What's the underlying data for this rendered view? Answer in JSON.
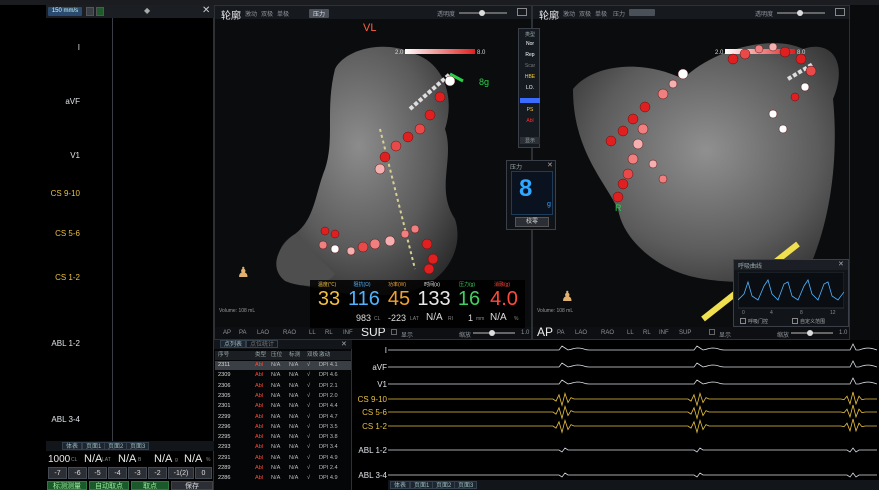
{
  "top": {
    "speed": "150 mm/s"
  },
  "left_panel": {
    "channels": [
      {
        "label": "I",
        "cs": false
      },
      {
        "label": "aVF",
        "cs": false
      },
      {
        "label": "V1",
        "cs": false
      },
      {
        "label": "CS 9-10",
        "cs": true
      },
      {
        "label": "CS 5-6",
        "cs": true
      },
      {
        "label": "CS 1-2",
        "cs": true
      },
      {
        "label": "ABL 1-2",
        "cs": false
      },
      {
        "label": "ABL 3-4",
        "cs": false
      }
    ],
    "tabs": [
      "体表",
      "页面1",
      "页面2",
      "页面3"
    ],
    "cl_row": {
      "cl_value": "1000",
      "cl_unit": "CL",
      "lat": "N/A",
      "lat_unit": "LAT",
      "b": "N/A",
      "b_unit": "B",
      "g": "N/A",
      "g_unit": "g",
      "pct": "N/A",
      "pct_unit": "%"
    },
    "steps": [
      "-7",
      "-6",
      "-5",
      "-4",
      "-3",
      "-2",
      "-1(2)",
      "0"
    ],
    "bottom_buttons": [
      "标测测量",
      "自动取点",
      "取点",
      "保存"
    ]
  },
  "viewport_left": {
    "title": "轮廓",
    "menu": [
      "激动",
      "双极",
      "单极",
      "压力"
    ],
    "transparency_label": "透明度",
    "scale_min": "2.0",
    "scale_max": "8.0",
    "volume": "Volume: 108 mL",
    "views": [
      "AP",
      "PA",
      "LAO",
      "RAO",
      "LL",
      "RL",
      "INF"
    ],
    "current_view": "SUP",
    "display_toggle": "显示",
    "zoom_label": "缩放",
    "zoom_value": "1.0",
    "label_top": "VL",
    "force_marker": "8g"
  },
  "viewport_right": {
    "title": "轮廓",
    "menu": [
      "激动",
      "双极",
      "单极",
      "压力"
    ],
    "transparency_label": "透明度",
    "scale_min": "2.0",
    "scale_max": "8.0",
    "volume": "Volume: 108 mL",
    "views": [
      "PA",
      "LAO",
      "RAO",
      "LL",
      "RL",
      "INF",
      "SUP"
    ],
    "current_view": "AP",
    "display_toggle": "显示",
    "zoom_label": "缩放",
    "zoom_value": "1.0",
    "marker_r": "R"
  },
  "legend": {
    "title": "类型",
    "items": [
      {
        "label": "Nor",
        "color": "#ffffff"
      },
      {
        "label": "Rep",
        "color": "#ffffff"
      },
      {
        "label": "Scar",
        "color": "#7a7a7a"
      },
      {
        "label": "HBE",
        "color": "#ffd23a"
      },
      {
        "label": "LO.",
        "color": "#ffffff"
      },
      {
        "label": "",
        "color": "#3a6cff"
      },
      {
        "label": "PS",
        "color": "#ffd23a"
      },
      {
        "label": "Abl",
        "color": "#ff3030"
      }
    ],
    "footer": "显示"
  },
  "force_panel": {
    "title": "压力",
    "value": "8",
    "unit": "g",
    "button": "校零"
  },
  "readout": {
    "cells": [
      {
        "label": "温度(℃)",
        "value": "33",
        "color": "#f0c040"
      },
      {
        "label": "阻抗(Ω)",
        "value": "116",
        "color": "#4fb3ff"
      },
      {
        "label": "功率(W)",
        "value": "45",
        "color": "#f0a030"
      },
      {
        "label": "时间(s)",
        "value": "133",
        "color": "#e8e8e8"
      },
      {
        "label": "压力(g)",
        "value": "16",
        "color": "#40d060"
      },
      {
        "label": "消融(g)",
        "value": "4.0",
        "color": "#ff4a3a"
      }
    ],
    "sub": {
      "cl": "983",
      "cl_unit": "CL",
      "lat": "-223",
      "lat_unit": "LAT",
      "ri": "N/A",
      "ri_unit": "RI",
      "mm": "1",
      "mm_unit": "mm",
      "pct": "N/A",
      "pct_unit": "%"
    }
  },
  "respiration": {
    "title": "呼吸曲线",
    "x_ticks": [
      "0",
      "4",
      "8",
      "12"
    ],
    "opt1": "呼吸门控",
    "opt2": "自定义范围"
  },
  "table": {
    "tabs": [
      "点列表",
      "点位统计"
    ],
    "headers": [
      "序号",
      "类型",
      "压位",
      "标测",
      "双极",
      "激动"
    ],
    "rows": [
      [
        "2311",
        "Abl",
        "N/A",
        "N/A",
        "√",
        "DPI 4.1"
      ],
      [
        "2309",
        "Abl",
        "N/A",
        "N/A",
        "√",
        "DPI 4.6"
      ],
      [
        "2306",
        "Abl",
        "N/A",
        "N/A",
        "√",
        "DPI 2.1"
      ],
      [
        "2305",
        "Abl",
        "N/A",
        "N/A",
        "√",
        "DPI 2.0"
      ],
      [
        "2301",
        "Abl",
        "N/A",
        "N/A",
        "√",
        "DPI 4.4"
      ],
      [
        "2299",
        "Abl",
        "N/A",
        "N/A",
        "√",
        "DPI 4.7"
      ],
      [
        "2296",
        "Abl",
        "N/A",
        "N/A",
        "√",
        "DPI 3.5"
      ],
      [
        "2295",
        "Abl",
        "N/A",
        "N/A",
        "√",
        "DPI 3.8"
      ],
      [
        "2293",
        "Abl",
        "N/A",
        "N/A",
        "√",
        "DPI 3.4"
      ],
      [
        "2291",
        "Abl",
        "N/A",
        "N/A",
        "√",
        "DPI 4.9"
      ],
      [
        "2289",
        "Abl",
        "N/A",
        "N/A",
        "√",
        "DPI 2.4"
      ],
      [
        "2286",
        "Abl",
        "N/A",
        "N/A",
        "√",
        "DPI 4.9"
      ]
    ]
  },
  "traces": {
    "channels": [
      {
        "label": "I",
        "cs": false
      },
      {
        "label": "aVF",
        "cs": false
      },
      {
        "label": "V1",
        "cs": false
      },
      {
        "label": "CS 9-10",
        "cs": true
      },
      {
        "label": "CS 5-6",
        "cs": true
      },
      {
        "label": "CS 1-2",
        "cs": true
      },
      {
        "label": "ABL 1-2",
        "cs": false
      },
      {
        "label": "ABL 3-4",
        "cs": false
      }
    ],
    "tabs": [
      "体表",
      "页面1",
      "页面2",
      "页面3"
    ]
  }
}
